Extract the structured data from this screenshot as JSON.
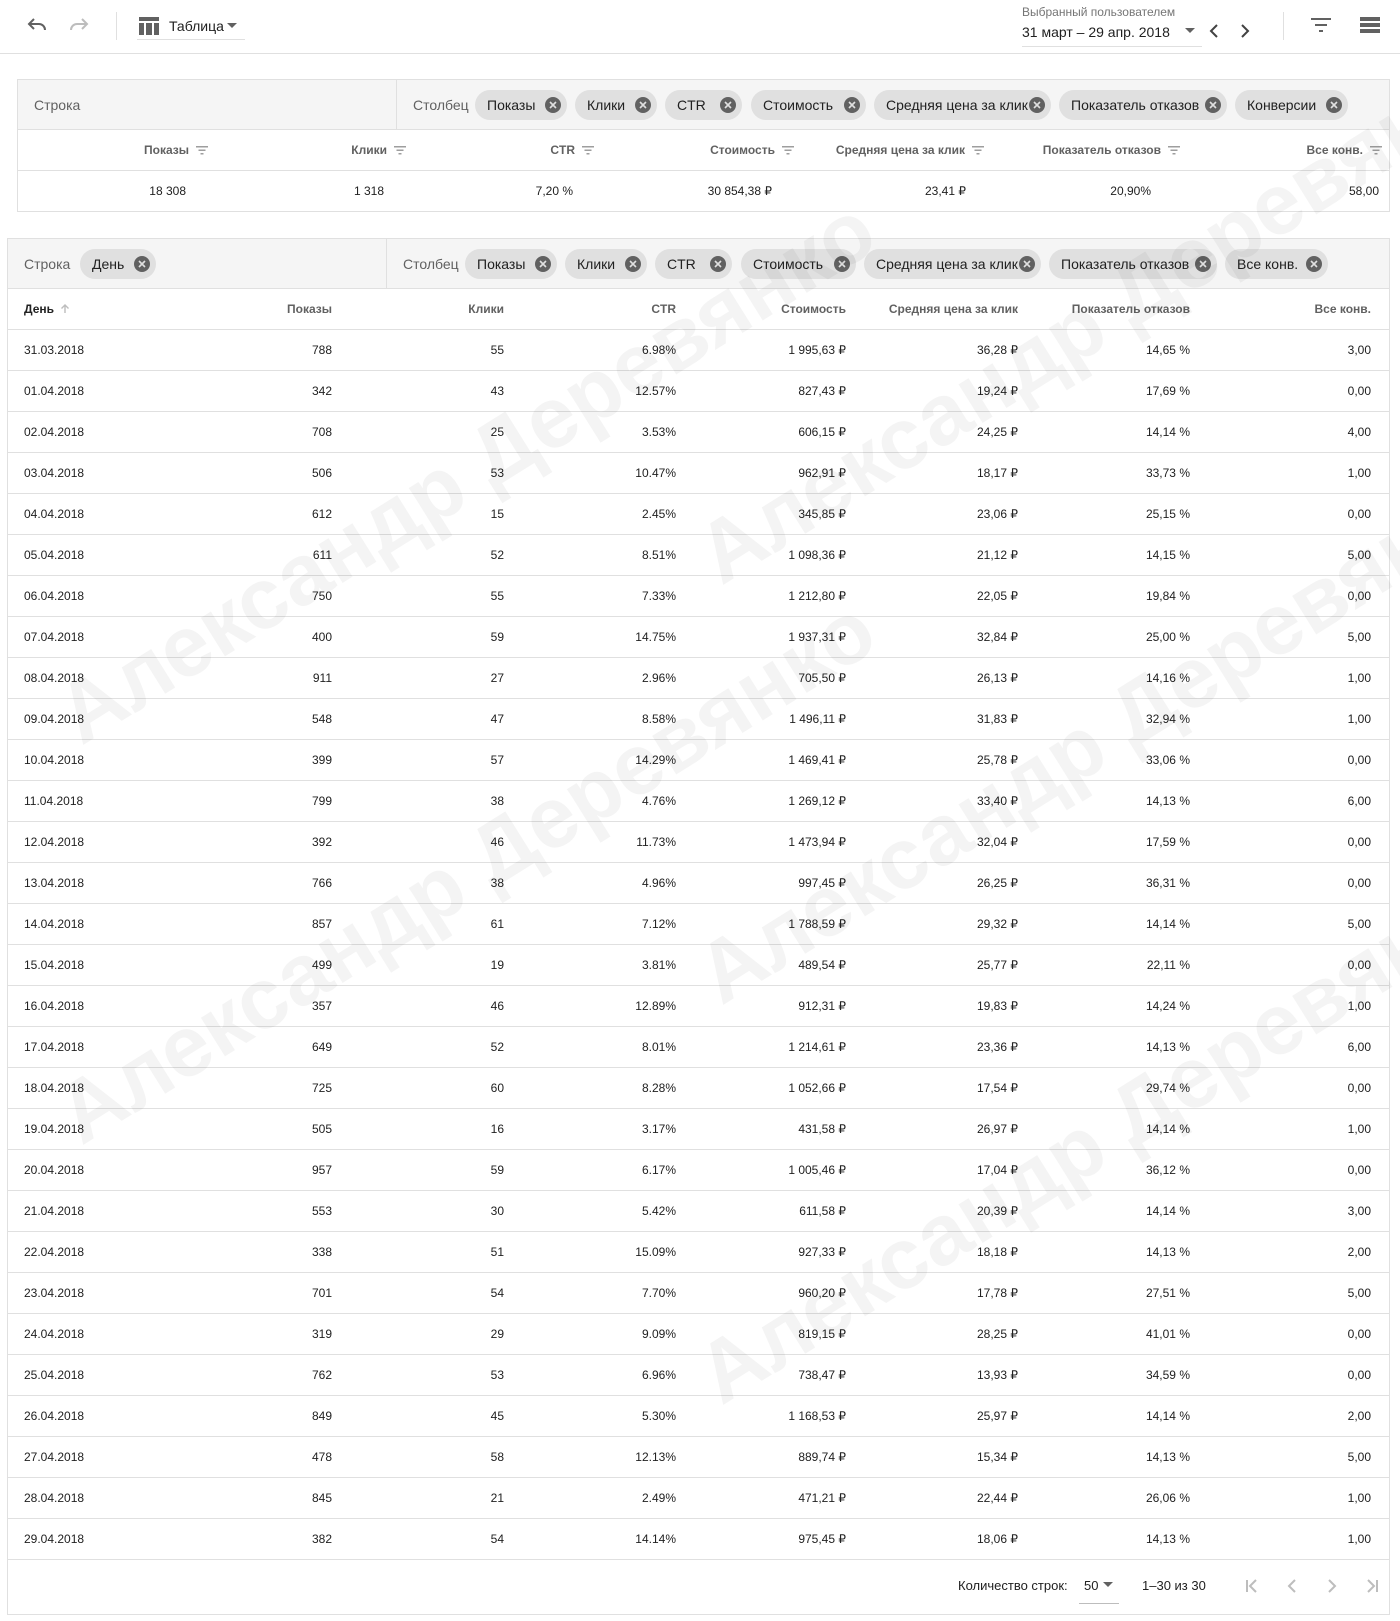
{
  "toolbar": {
    "view_label": "Таблица",
    "date_caption": "Выбранный пользователем",
    "date_range": "31 март – 29 апр. 2018"
  },
  "summary": {
    "row_label": "Строка",
    "column_label": "Столбец",
    "chips": [
      "Показы",
      "Клики",
      "CTR",
      "Стоимость",
      "Средняя цена за клик",
      "Показатель отказов",
      "Конверсии"
    ],
    "headers": [
      "Показы",
      "Клики",
      "CTR",
      "Стоимость",
      "Средняя цена за клик",
      "Показатель отказов",
      "Все конв."
    ],
    "values": [
      "18 308",
      "1 318",
      "7,20 %",
      "30 854,38 ₽",
      "23,41 ₽",
      "20,90%",
      "58,00"
    ]
  },
  "table": {
    "row_label": "Строка",
    "row_chip": "День",
    "column_label": "Столбец",
    "chips": [
      "Показы",
      "Клики",
      "CTR",
      "Стоимость",
      "Средняя цена за клик",
      "Показатель отказов",
      "Все конв."
    ],
    "headers": [
      "День",
      "Показы",
      "Клики",
      "CTR",
      "Стоимость",
      "Средняя цена за клик",
      "Показатель отказов",
      "Все конв."
    ],
    "rows": [
      [
        "31.03.2018",
        "788",
        "55",
        "6.98%",
        "1 995,63 ₽",
        "36,28 ₽",
        "14,65 %",
        "3,00"
      ],
      [
        "01.04.2018",
        "342",
        "43",
        "12.57%",
        "827,43 ₽",
        "19,24 ₽",
        "17,69 %",
        "0,00"
      ],
      [
        "02.04.2018",
        "708",
        "25",
        "3.53%",
        "606,15 ₽",
        "24,25 ₽",
        "14,14 %",
        "4,00"
      ],
      [
        "03.04.2018",
        "506",
        "53",
        "10.47%",
        "962,91 ₽",
        "18,17 ₽",
        "33,73 %",
        "1,00"
      ],
      [
        "04.04.2018",
        "612",
        "15",
        "2.45%",
        "345,85 ₽",
        "23,06 ₽",
        "25,15 %",
        "0,00"
      ],
      [
        "05.04.2018",
        "611",
        "52",
        "8.51%",
        "1 098,36 ₽",
        "21,12 ₽",
        "14,15 %",
        "5,00"
      ],
      [
        "06.04.2018",
        "750",
        "55",
        "7.33%",
        "1 212,80 ₽",
        "22,05 ₽",
        "19,84 %",
        "0,00"
      ],
      [
        "07.04.2018",
        "400",
        "59",
        "14.75%",
        "1 937,31 ₽",
        "32,84 ₽",
        "25,00 %",
        "5,00"
      ],
      [
        "08.04.2018",
        "911",
        "27",
        "2.96%",
        "705,50 ₽",
        "26,13 ₽",
        "14,16 %",
        "1,00"
      ],
      [
        "09.04.2018",
        "548",
        "47",
        "8.58%",
        "1 496,11 ₽",
        "31,83 ₽",
        "32,94 %",
        "1,00"
      ],
      [
        "10.04.2018",
        "399",
        "57",
        "14.29%",
        "1 469,41 ₽",
        "25,78 ₽",
        "33,06 %",
        "0,00"
      ],
      [
        "11.04.2018",
        "799",
        "38",
        "4.76%",
        "1 269,12 ₽",
        "33,40 ₽",
        "14,13 %",
        "6,00"
      ],
      [
        "12.04.2018",
        "392",
        "46",
        "11.73%",
        "1 473,94 ₽",
        "32,04 ₽",
        "17,59 %",
        "0,00"
      ],
      [
        "13.04.2018",
        "766",
        "38",
        "4.96%",
        "997,45 ₽",
        "26,25 ₽",
        "36,31 %",
        "0,00"
      ],
      [
        "14.04.2018",
        "857",
        "61",
        "7.12%",
        "1 788,59 ₽",
        "29,32 ₽",
        "14,14 %",
        "5,00"
      ],
      [
        "15.04.2018",
        "499",
        "19",
        "3.81%",
        "489,54 ₽",
        "25,77 ₽",
        "22,11 %",
        "0,00"
      ],
      [
        "16.04.2018",
        "357",
        "46",
        "12.89%",
        "912,31 ₽",
        "19,83 ₽",
        "14,24 %",
        "1,00"
      ],
      [
        "17.04.2018",
        "649",
        "52",
        "8.01%",
        "1 214,61 ₽",
        "23,36 ₽",
        "14,13 %",
        "6,00"
      ],
      [
        "18.04.2018",
        "725",
        "60",
        "8.28%",
        "1 052,66 ₽",
        "17,54 ₽",
        "29,74 %",
        "0,00"
      ],
      [
        "19.04.2018",
        "505",
        "16",
        "3.17%",
        "431,58 ₽",
        "26,97 ₽",
        "14,14 %",
        "1,00"
      ],
      [
        "20.04.2018",
        "957",
        "59",
        "6.17%",
        "1 005,46 ₽",
        "17,04 ₽",
        "36,12 %",
        "0,00"
      ],
      [
        "21.04.2018",
        "553",
        "30",
        "5.42%",
        "611,58 ₽",
        "20,39 ₽",
        "14,14 %",
        "3,00"
      ],
      [
        "22.04.2018",
        "338",
        "51",
        "15.09%",
        "927,33 ₽",
        "18,18 ₽",
        "14,13 %",
        "2,00"
      ],
      [
        "23.04.2018",
        "701",
        "54",
        "7.70%",
        "960,20 ₽",
        "17,78 ₽",
        "27,51 %",
        "5,00"
      ],
      [
        "24.04.2018",
        "319",
        "29",
        "9.09%",
        "819,15 ₽",
        "28,25 ₽",
        "41,01 %",
        "0,00"
      ],
      [
        "25.04.2018",
        "762",
        "53",
        "6.96%",
        "738,47 ₽",
        "13,93 ₽",
        "34,59 %",
        "0,00"
      ],
      [
        "26.04.2018",
        "849",
        "45",
        "5.30%",
        "1 168,53 ₽",
        "25,97 ₽",
        "14,14 %",
        "2,00"
      ],
      [
        "27.04.2018",
        "478",
        "58",
        "12.13%",
        "889,74 ₽",
        "15,34 ₽",
        "14,13 %",
        "5,00"
      ],
      [
        "28.04.2018",
        "845",
        "21",
        "2.49%",
        "471,21 ₽",
        "22,44 ₽",
        "26,06 %",
        "1,00"
      ],
      [
        "29.04.2018",
        "382",
        "54",
        "14.14%",
        "975,45 ₽",
        "18,06 ₽",
        "14,13 %",
        "1,00"
      ]
    ]
  },
  "footer": {
    "rows_label": "Количество строк:",
    "rows_value": "50",
    "range": "1–30 из 30"
  },
  "watermark": "Александр Деревянко",
  "colors": {
    "chip_bg": "#e0e0e0",
    "bar_bg": "#f5f5f5",
    "border": "#e0e0e0",
    "icon": "#616161"
  }
}
